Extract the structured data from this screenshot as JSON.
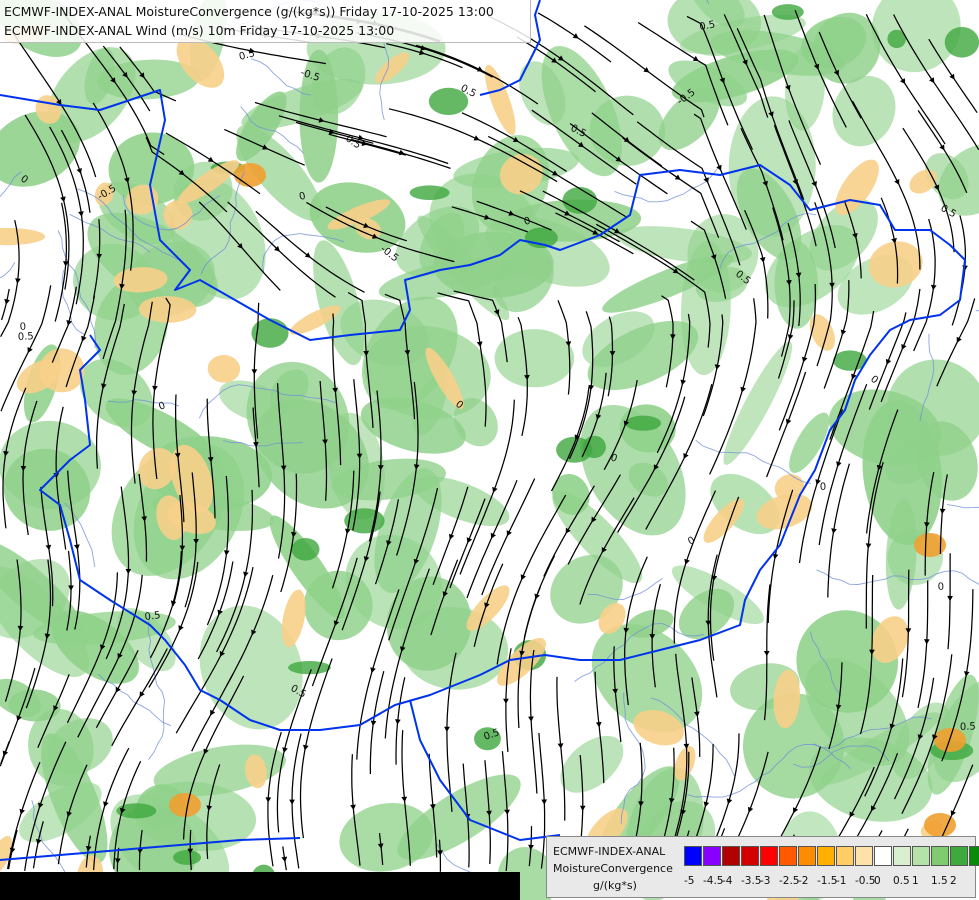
{
  "titles": {
    "line1": "ECMWF-INDEX-ANAL MoistureConvergence (g/(kg*s)) Friday 17-10-2025 13:00",
    "line2": "ECMWF-INDEX-ANAL Wind (m/s) 10m Friday 17-10-2025 13:00"
  },
  "legend": {
    "model": "ECMWF-INDEX-ANAL",
    "parameter": "MoistureConvergence",
    "unit": "g/(kg*s)",
    "colors": [
      "#0000ff",
      "#8800ff",
      "#b20000",
      "#d40000",
      "#ff0000",
      "#ff5a00",
      "#ff8c00",
      "#ffb000",
      "#ffcc66",
      "#ffe2a8",
      "#ffffff",
      "#d8f0d0",
      "#b4e2a8",
      "#7fcc70",
      "#3eaa3e",
      "#0a8a0a"
    ],
    "ticks": [
      "-5",
      "-4.5",
      "-4",
      "-3.5",
      "-3",
      "-2.5",
      "-2",
      "-1.5",
      "-1",
      "-0.5",
      "0",
      "0.5",
      "1",
      "1.5",
      "2"
    ]
  },
  "contour_labels": [
    "0",
    "0.5",
    "-0.5"
  ],
  "map_style": {
    "border_color": "#0033ee",
    "river_color": "#6f8fd8",
    "streamline_color": "#000000",
    "convergence_color": "#8fd18a",
    "divergence_color": "#f7cf8a",
    "void_color": "#000000"
  }
}
